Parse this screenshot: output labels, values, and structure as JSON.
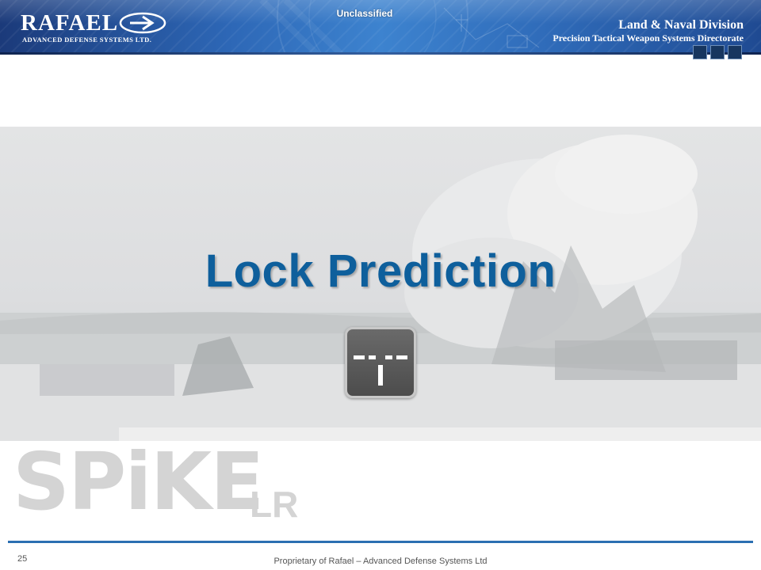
{
  "header": {
    "logo_name": "RAFAEL",
    "logo_tagline": "ADVANCED DEFENSE SYSTEMS LTD.",
    "classification": "Unclassified",
    "division": "Land & Naval Division",
    "directorate": "Precision Tactical Weapon Systems Directorate"
  },
  "slide": {
    "title": "Lock Prediction",
    "icon": "lock-prediction-icon"
  },
  "product_logo": {
    "name": "SPiKE",
    "variant": "LR"
  },
  "footer": {
    "page_number": "25",
    "text": "Proprietary of Rafael – Advanced Defense Systems Ltd"
  },
  "colors": {
    "banner": "#2d67b6",
    "title": "#0e5f9c",
    "footer_rule": "#2b6fb2",
    "product_logo": "#d4d4d4"
  }
}
